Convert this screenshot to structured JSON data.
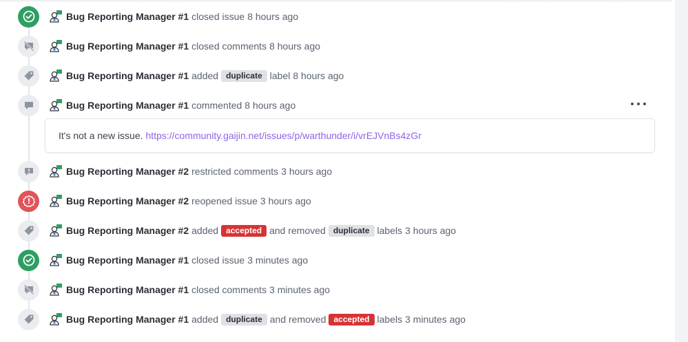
{
  "events": [
    {
      "author": "Bug Reporting Manager #1",
      "action": "closed issue",
      "time": "8 hours ago",
      "icon": "check-circle-icon"
    },
    {
      "author": "Bug Reporting Manager #1",
      "action": "closed comments",
      "time": "8 hours ago",
      "icon": "comment-off-icon"
    },
    {
      "author": "Bug Reporting Manager #1",
      "action": "added",
      "label": "duplicate",
      "after": "label",
      "time": "8 hours ago",
      "icon": "tag-icon"
    },
    {
      "author": "Bug Reporting Manager #1",
      "action": "commented",
      "time": "8 hours ago",
      "icon": "comment-icon"
    },
    {
      "author": "Bug Reporting Manager #2",
      "action": "restricted comments",
      "time": "3 hours ago",
      "icon": "comment-alert-icon"
    },
    {
      "author": "Bug Reporting Manager #2",
      "action": "reopened issue",
      "time": "3 hours ago",
      "icon": "alert-circle-icon"
    },
    {
      "author": "Bug Reporting Manager #2",
      "action": "added",
      "label": "accepted",
      "middle": "and removed",
      "label2": "duplicate",
      "after": "labels",
      "time": "3 hours ago",
      "icon": "tag-icon"
    },
    {
      "author": "Bug Reporting Manager #1",
      "action": "closed issue",
      "time": "3 minutes ago",
      "icon": "check-circle-icon"
    },
    {
      "author": "Bug Reporting Manager #1",
      "action": "closed comments",
      "time": "3 minutes ago",
      "icon": "comment-off-icon"
    },
    {
      "author": "Bug Reporting Manager #1",
      "action": "added",
      "label": "duplicate",
      "middle": "and removed",
      "label2": "accepted",
      "after": "labels",
      "time": "3 minutes ago",
      "icon": "tag-icon"
    }
  ],
  "comment": {
    "text": "It's not a new issue.",
    "link": "https://community.gaijin.net/issues/p/warthunder/i/vrEJVnBs4zGr"
  },
  "colors": {
    "closed": "#2e9e63",
    "reopened": "#e0545a",
    "accepted_label": "#d63336",
    "duplicate_label": "#dfe1e4",
    "link": "#8d63e6"
  }
}
